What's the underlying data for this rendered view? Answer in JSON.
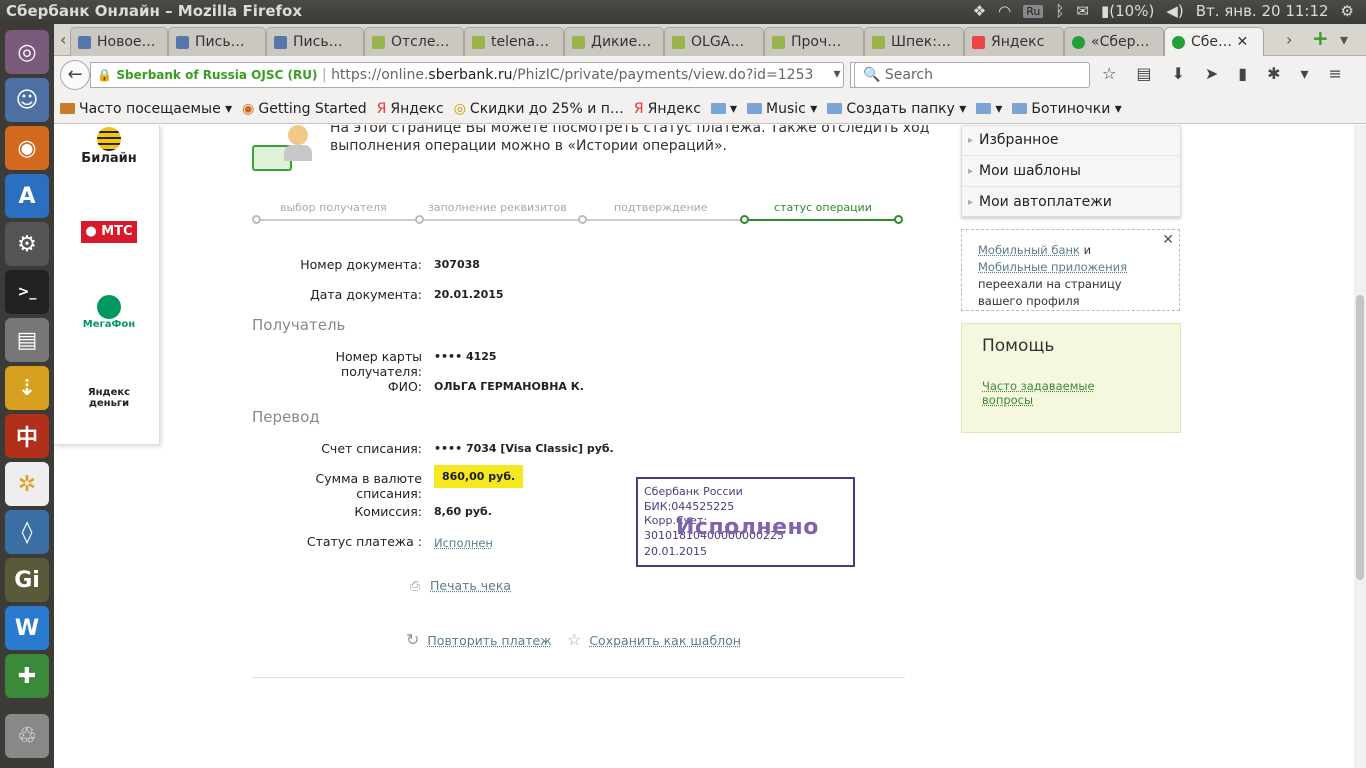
{
  "system": {
    "window_title": "Сбербанк Онлайн – Mozilla Firefox",
    "battery": "(10%)",
    "keyboard": "Ru",
    "clock": "Вт. янв. 20 11:12"
  },
  "tabs": [
    {
      "label": "Новое…",
      "color": "#5577aa"
    },
    {
      "label": "Пись…",
      "color": "#5577aa"
    },
    {
      "label": "Пись…",
      "color": "#5577aa"
    },
    {
      "label": "Отсле…",
      "color": "#9ab24a"
    },
    {
      "label": "telena…",
      "color": "#9ab24a"
    },
    {
      "label": "Дикие…",
      "color": "#9ab24a"
    },
    {
      "label": "OLGA…",
      "color": "#9ab24a"
    },
    {
      "label": "Проч…",
      "color": "#9ab24a"
    },
    {
      "label": "Шпек:…",
      "color": "#9ab24a"
    },
    {
      "label": "Яндекс",
      "color": "#e44"
    },
    {
      "label": "«Сбер…",
      "color": "#21a038"
    },
    {
      "label": "Сбе…",
      "color": "#21a038"
    }
  ],
  "nav": {
    "identity": "Sberbank of Russia OJSC (RU)",
    "url_prefix": "https://online.",
    "url_host": "sberbank.ru",
    "url_path": "/PhizIC/private/payments/view.do?id=1253",
    "search_placeholder": "Search"
  },
  "bookmarks": [
    "Часто посещаемые ▾",
    "Getting Started",
    "Яндекс",
    "Скидки до 25% и п…",
    "Яндекс",
    "▾",
    "Music ▾",
    "Создать папку ▾",
    "▾",
    "Ботиночки ▾"
  ],
  "operators": [
    "Билайн",
    "МТС",
    "МегаФон",
    "Яндекс деньги"
  ],
  "intro": {
    "line1": "На этой странице Вы можете посмотреть статус платежа. Также отследить ход",
    "line2": "выполнения операции можно в «Истории операций»."
  },
  "steps": [
    "выбор получателя",
    "заполнение реквизитов",
    "подтверждение",
    "статус операции"
  ],
  "document": {
    "number_label": "Номер документа:",
    "number": "307038",
    "date_label": "Дата документа:",
    "date": "20.01.2015"
  },
  "recipient": {
    "section": "Получатель",
    "card_label": "Номер карты получателя:",
    "card": "•••• 4125",
    "name_label": "ФИО:",
    "name": "ОЛЬГА ГЕРМАНОВНА К."
  },
  "transfer": {
    "section": "Перевод",
    "account_label": "Счет списания:",
    "account": "•••• 7034  [Visa Classic]  руб.",
    "amount_label": "Сумма в валюте списания:",
    "amount": "860,00  руб.",
    "fee_label": "Комиссия:",
    "fee": "8,60 руб.",
    "status_label": "Статус платежа :",
    "status": "Исполнен"
  },
  "stamp": {
    "bank": "Сбербанк России",
    "bik": "БИК:044525225",
    "corr": "Корр.Счет: 30101810400000000225",
    "status": "Исполнено",
    "date": "20.01.2015"
  },
  "actions": {
    "print": "Печать чека",
    "repeat": "Повторить платеж",
    "save": "Сохранить как шаблон"
  },
  "sidemenu": [
    "Избранное",
    "Мои шаблоны",
    "Мои автоплатежи"
  ],
  "notice": {
    "link1": "Мобильный банк",
    "and": " и ",
    "link2": "Мобильные приложения",
    "rest": " переехали на страницу вашего профиля"
  },
  "help": {
    "title": "Помощь",
    "faq": "Часто задаваемые вопросы"
  },
  "colors": {
    "accent": "#2e8b2e",
    "highlight": "#f5e820",
    "stamp": "#4e3a7e"
  }
}
